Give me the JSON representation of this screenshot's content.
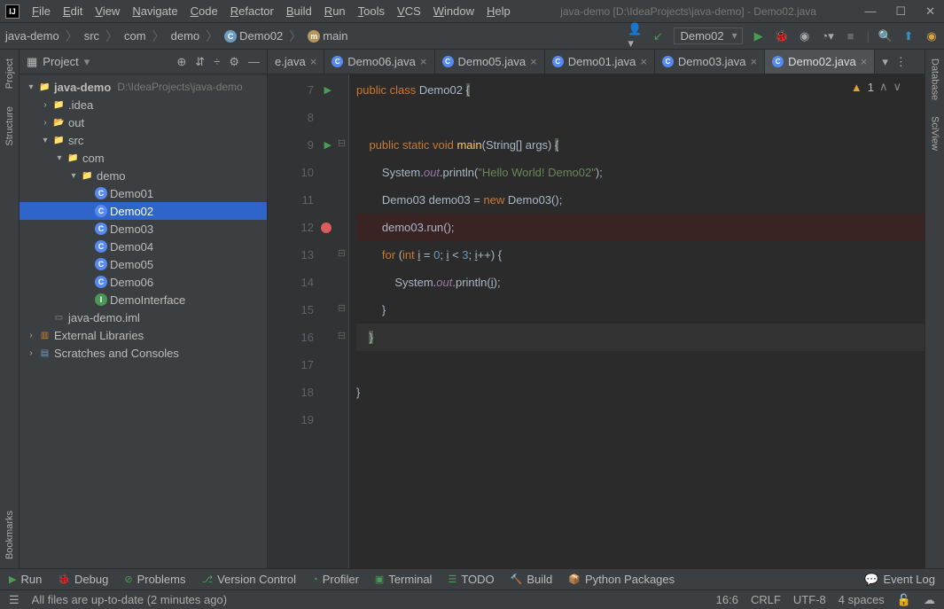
{
  "title": "java-demo [D:\\IdeaProjects\\java-demo] - Demo02.java",
  "menu": [
    "File",
    "Edit",
    "View",
    "Navigate",
    "Code",
    "Refactor",
    "Build",
    "Run",
    "Tools",
    "VCS",
    "Window",
    "Help"
  ],
  "breadcrumb": [
    "java-demo",
    "src",
    "com",
    "demo",
    "Demo02",
    "main"
  ],
  "runconfig": "Demo02",
  "projectLabel": "Project",
  "tree": {
    "root": "java-demo",
    "rootPath": "D:\\IdeaProjects\\java-demo",
    "idea": ".idea",
    "out": "out",
    "src": "src",
    "com": "com",
    "demo": "demo",
    "classes": [
      "Demo01",
      "Demo02",
      "Demo03",
      "Demo04",
      "Demo05",
      "Demo06"
    ],
    "iface": "DemoInterface",
    "iml": "java-demo.iml",
    "ext": "External Libraries",
    "scratch": "Scratches and Consoles"
  },
  "tabs": [
    {
      "label": "e.java",
      "truncated": true
    },
    {
      "label": "Demo06.java"
    },
    {
      "label": "Demo05.java"
    },
    {
      "label": "Demo01.java"
    },
    {
      "label": "Demo03.java"
    },
    {
      "label": "Demo02.java",
      "active": true
    }
  ],
  "inspection": {
    "warnings": "1"
  },
  "code": {
    "startLine": 7,
    "lines": [
      {
        "n": 7,
        "run": true,
        "seg": [
          {
            "t": "public ",
            "c": "kw"
          },
          {
            "t": "class ",
            "c": "kw"
          },
          {
            "t": "Demo02 ",
            "c": ""
          },
          {
            "t": "{",
            "c": "hl"
          }
        ]
      },
      {
        "n": 8,
        "seg": []
      },
      {
        "n": 9,
        "run": true,
        "fold": "⊟",
        "seg": [
          {
            "t": "    ",
            "c": ""
          },
          {
            "t": "public static void ",
            "c": "kw"
          },
          {
            "t": "main",
            "c": "fn"
          },
          {
            "t": "(String[] args) ",
            "c": ""
          },
          {
            "t": "{",
            "c": "hl"
          }
        ]
      },
      {
        "n": 10,
        "seg": [
          {
            "t": "        System.",
            "c": ""
          },
          {
            "t": "out",
            "c": "fld"
          },
          {
            "t": ".println(",
            "c": ""
          },
          {
            "t": "\"Hello World! Demo02\"",
            "c": "str"
          },
          {
            "t": ");",
            "c": ""
          }
        ]
      },
      {
        "n": 11,
        "seg": [
          {
            "t": "        Demo03 demo03 = ",
            "c": ""
          },
          {
            "t": "new ",
            "c": "kw"
          },
          {
            "t": "Demo03();",
            "c": ""
          }
        ]
      },
      {
        "n": 12,
        "bp": true,
        "seg": [
          {
            "t": "        demo03.run();",
            "c": ""
          }
        ]
      },
      {
        "n": 13,
        "fold": "⊟",
        "seg": [
          {
            "t": "        ",
            "c": ""
          },
          {
            "t": "for ",
            "c": "kw"
          },
          {
            "t": "(",
            "c": ""
          },
          {
            "t": "int ",
            "c": "kw"
          },
          {
            "t": "i",
            "c": "ul"
          },
          {
            "t": " = ",
            "c": ""
          },
          {
            "t": "0",
            "c": "num"
          },
          {
            "t": "; ",
            "c": ""
          },
          {
            "t": "i",
            "c": "ul"
          },
          {
            "t": " < ",
            "c": ""
          },
          {
            "t": "3",
            "c": "num"
          },
          {
            "t": "; ",
            "c": ""
          },
          {
            "t": "i",
            "c": "ul"
          },
          {
            "t": "++) {",
            "c": ""
          }
        ]
      },
      {
        "n": 14,
        "seg": [
          {
            "t": "            System.",
            "c": ""
          },
          {
            "t": "out",
            "c": "fld"
          },
          {
            "t": ".println(",
            "c": ""
          },
          {
            "t": "i",
            "c": "ul"
          },
          {
            "t": ");",
            "c": ""
          }
        ]
      },
      {
        "n": 15,
        "fold": "⊟",
        "seg": [
          {
            "t": "        }",
            "c": ""
          }
        ]
      },
      {
        "n": 16,
        "caret": true,
        "fold": "⊟",
        "seg": [
          {
            "t": "    ",
            "c": ""
          },
          {
            "t": "}",
            "c": "hl"
          }
        ]
      },
      {
        "n": 17,
        "seg": []
      },
      {
        "n": 18,
        "seg": [
          {
            "t": "}",
            "c": ""
          }
        ]
      },
      {
        "n": 19,
        "seg": []
      }
    ]
  },
  "bottom": [
    "Run",
    "Debug",
    "Problems",
    "Version Control",
    "Profiler",
    "Terminal",
    "TODO",
    "Build",
    "Python Packages"
  ],
  "eventLog": "Event Log",
  "status": {
    "msg": "All files are up-to-date (2 minutes ago)",
    "pos": "16:6",
    "eol": "CRLF",
    "enc": "UTF-8",
    "indent": "4 spaces"
  },
  "leftTabs": [
    "Project",
    "Structure",
    "Bookmarks"
  ],
  "rightTabs": [
    "Database",
    "SciView"
  ]
}
